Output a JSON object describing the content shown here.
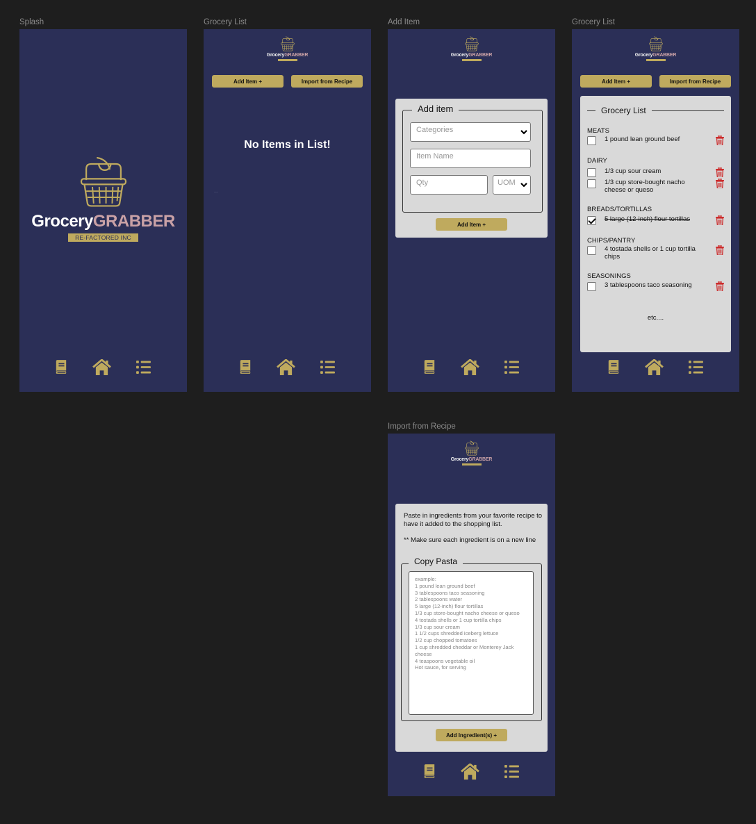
{
  "frames": {
    "splash": {
      "label": "Splash"
    },
    "grocery_list_empty": {
      "label": "Grocery List"
    },
    "add_item": {
      "label": "Add Item"
    },
    "grocery_list_filled": {
      "label": "Grocery List"
    },
    "import_recipe": {
      "label": "Import from Recipe"
    }
  },
  "brand": {
    "word1": "Grocery",
    "word2": "GRABBER",
    "tagline": "RE-FACTORED INC",
    "colors": {
      "background": "#2b2f57",
      "gold": "#bfaa5e",
      "pink": "#c9a1a6",
      "panel": "#d9d9d9",
      "danger": "#cc2b2b"
    }
  },
  "actions": {
    "add_item": "Add Item +",
    "import_recipe": "Import from Recipe",
    "add_ingredients": "Add Ingredient(s) +"
  },
  "empty_state": {
    "message": "No Items in List!",
    "dots": "..."
  },
  "add_item_form": {
    "legend": "Add item",
    "categories_placeholder": "Categories",
    "item_name_placeholder": "Item Name",
    "qty_placeholder": "Qty",
    "uom_placeholder": "UOM"
  },
  "grocery_list": {
    "title": "Grocery List",
    "categories": [
      {
        "name": "MEATS",
        "items": [
          {
            "text": "1 pound lean ground beef",
            "checked": false
          }
        ]
      },
      {
        "name": "DAIRY",
        "items": [
          {
            "text": "1/3 cup sour cream",
            "checked": false
          },
          {
            "text": "1/3 cup store-bought nacho cheese or queso",
            "checked": false
          }
        ]
      },
      {
        "name": "BREADS/TORTILLAS",
        "items": [
          {
            "text": "5 large (12-inch) flour tortillas",
            "checked": true
          }
        ]
      },
      {
        "name": "CHIPS/PANTRY",
        "items": [
          {
            "text": "4 tostada shells or 1 cup tortilla chips",
            "checked": false
          }
        ]
      },
      {
        "name": "SEASONINGS",
        "items": [
          {
            "text": "3 tablespoons taco seasoning",
            "checked": false
          }
        ]
      }
    ],
    "more": "etc...."
  },
  "import": {
    "instructions": "Paste in ingredients from your favorite recipe to have it added to the shopping list.",
    "note": "** Make sure each ingredient is on a new line",
    "legend": "Copy Pasta",
    "placeholder": "example:\n1 pound lean ground beef\n3 tablespoons taco seasoning\n2 tablespoons water\n5 large (12-inch) flour tortillas\n1/3 cup store-bought nacho cheese or queso\n4 tostada shells or 1 cup tortilla chips\n1/3 cup sour cream\n1 1/2 cups shredded iceberg lettuce\n1/2 cup chopped tomatoes\n1 cup shredded cheddar or Monterey Jack cheese\n4 teaspoons vegetable oil\nHot sauce, for serving"
  },
  "nav": {
    "items": [
      {
        "icon": "book-icon",
        "label": "Recipes"
      },
      {
        "icon": "home-icon",
        "label": "Home"
      },
      {
        "icon": "list-icon",
        "label": "List"
      }
    ]
  }
}
